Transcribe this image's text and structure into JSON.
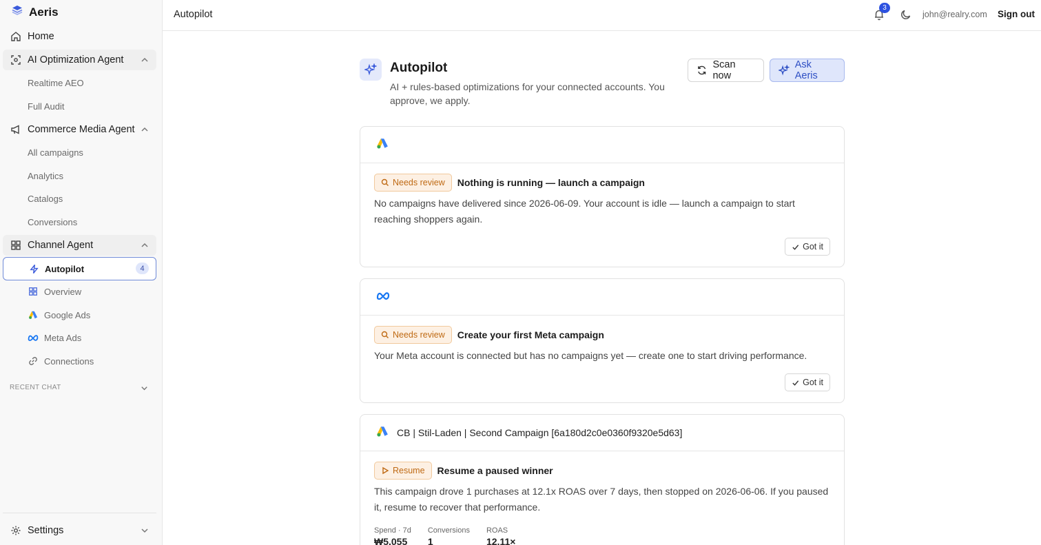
{
  "app": {
    "name": "Aeris"
  },
  "sidebar": {
    "home": "Home",
    "sections": [
      {
        "label": "AI Optimization Agent",
        "items": [
          "Realtime AEO",
          "Full Audit"
        ]
      },
      {
        "label": "Commerce Media Agent",
        "items": [
          "All campaigns",
          "Analytics",
          "Catalogs",
          "Conversions"
        ]
      },
      {
        "label": "Channel Agent"
      }
    ],
    "channel_items": [
      {
        "label": "Autopilot",
        "badge": "4"
      },
      {
        "label": "Overview"
      },
      {
        "label": "Google Ads"
      },
      {
        "label": "Meta Ads"
      },
      {
        "label": "Connections"
      }
    ],
    "recent_chat": "RECENT CHAT",
    "settings": "Settings"
  },
  "topbar": {
    "title": "Autopilot",
    "notification_count": "3",
    "user_email": "john@realry.com",
    "sign_out": "Sign out"
  },
  "header": {
    "title": "Autopilot",
    "subtitle": "AI + rules-based optimizations for your connected accounts. You approve, we apply.",
    "scan_label": "Scan now",
    "ask_label": "Ask Aeris"
  },
  "cards": [
    {
      "platform": "google-ads",
      "campaign": "",
      "pill": "Needs review",
      "title": "Nothing is running — launch a campaign",
      "description": "No campaigns have delivered since 2026-06-09. Your account is idle — launch a campaign to start reaching shoppers again.",
      "action": "Got it"
    },
    {
      "platform": "meta",
      "campaign": "",
      "pill": "Needs review",
      "title": "Create your first Meta campaign",
      "description": "Your Meta account is connected but has no campaigns yet — create one to start driving performance.",
      "action": "Got it"
    },
    {
      "platform": "google-ads",
      "campaign": "CB | Stil-Laden | Second Campaign [6a180d2c0e0360f9320e5d63]",
      "pill": "Resume",
      "title": "Resume a paused winner",
      "description": "This campaign drove 1 purchases at 12.1x ROAS over 7 days, then stopped on 2026-06-06. If you paused it, resume to recover that performance.",
      "metrics": [
        {
          "label": "Spend · 7d",
          "value": "₩5,055"
        },
        {
          "label": "Conversions",
          "value": "1"
        },
        {
          "label": "ROAS",
          "value": "12.11×"
        }
      ]
    }
  ],
  "colors": {
    "accent": "#2e4fc4",
    "accent_bg": "#dfe6fb",
    "pill_bg": "#fdf0e3",
    "pill_text": "#bf6a14"
  }
}
